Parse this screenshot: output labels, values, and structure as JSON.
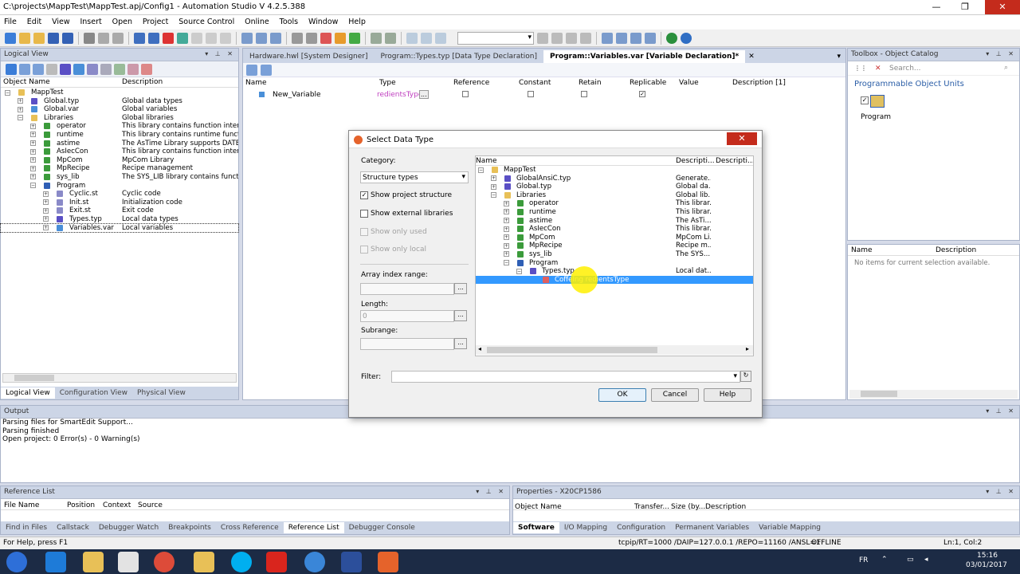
{
  "window": {
    "title": "C:\\projects\\MappTest\\MappTest.apj/Config1 - Automation Studio V 4.2.5.388"
  },
  "menu": [
    "File",
    "Edit",
    "View",
    "Insert",
    "Open",
    "Project",
    "Source Control",
    "Online",
    "Tools",
    "Window",
    "Help"
  ],
  "logical_view": {
    "title": "Logical View",
    "col_name": "Object Name",
    "col_desc": "Description",
    "rows": [
      {
        "name": "MappTest",
        "desc": ""
      },
      {
        "name": "Global.typ",
        "desc": "Global data types"
      },
      {
        "name": "Global.var",
        "desc": "Global variables"
      },
      {
        "name": "Libraries",
        "desc": "Global libraries"
      },
      {
        "name": "operator",
        "desc": "This library contains function interface"
      },
      {
        "name": "runtime",
        "desc": "This library contains runtime functions"
      },
      {
        "name": "astime",
        "desc": "The AsTime Library supports DATE_"
      },
      {
        "name": "AsIecCon",
        "desc": "This library contains function interface"
      },
      {
        "name": "MpCom",
        "desc": "MpCom Library"
      },
      {
        "name": "MpRecipe",
        "desc": "Recipe management"
      },
      {
        "name": "sys_lib",
        "desc": "The SYS_LIB library contains functior"
      },
      {
        "name": "Program",
        "desc": ""
      },
      {
        "name": "Cyclic.st",
        "desc": "Cyclic code"
      },
      {
        "name": "Init.st",
        "desc": "Initialization code"
      },
      {
        "name": "Exit.st",
        "desc": "Exit code"
      },
      {
        "name": "Types.typ",
        "desc": "Local data types"
      },
      {
        "name": "Variables.var",
        "desc": "Local variables"
      }
    ],
    "tabs": [
      "Logical View",
      "Configuration View",
      "Physical View"
    ]
  },
  "editor": {
    "tabs": [
      "Hardware.hwl [System Designer]",
      "Program::Types.typ [Data Type Declaration]",
      "Program::Variables.var [Variable Declaration]*"
    ],
    "columns": [
      "Name",
      "Type",
      "Reference",
      "Constant",
      "Retain",
      "Replicable",
      "Value",
      "Description [1]"
    ],
    "row": {
      "name": "New_Variable",
      "type": "redientsType",
      "type_btn": "..."
    }
  },
  "dialog": {
    "title": "Select Data Type",
    "close": "✕",
    "category_label": "Category:",
    "category_value": "Structure types",
    "show_project_structure": "Show project structure",
    "show_external_libraries": "Show external libraries",
    "show_only_used": "Show only used",
    "show_only_local": "Show only local",
    "array_index_range": "Array index range:",
    "length_label": "Length:",
    "length_value": "0",
    "subrange_label": "Subrange:",
    "filter_label": "Filter:",
    "ok": "OK",
    "cancel": "Cancel",
    "help": "Help",
    "tree_cols": [
      "Name",
      "Descripti...",
      "Descripti..."
    ],
    "tree": [
      {
        "name": "MappTest",
        "desc": ""
      },
      {
        "name": "GlobalAnsiC.typ",
        "desc": "Generate..."
      },
      {
        "name": "Global.typ",
        "desc": "Global da..."
      },
      {
        "name": "Libraries",
        "desc": "Global lib..."
      },
      {
        "name": "operator",
        "desc": "This librar..."
      },
      {
        "name": "runtime",
        "desc": "This librar..."
      },
      {
        "name": "astime",
        "desc": "The AsTi..."
      },
      {
        "name": "AsIecCon",
        "desc": "This librar..."
      },
      {
        "name": "MpCom",
        "desc": "MpCom Li..."
      },
      {
        "name": "MpRecipe",
        "desc": "Recipe m..."
      },
      {
        "name": "sys_lib",
        "desc": "The SYS..."
      },
      {
        "name": "Program",
        "desc": ""
      },
      {
        "name": "Types.typ",
        "desc": "Local dat..."
      },
      {
        "name": "CoffeIng   redientsType",
        "desc": ""
      }
    ]
  },
  "toolbox": {
    "title": "Toolbox - Object Catalog",
    "search_placeholder": "Search...",
    "section": "Programmable Object Units",
    "item": "Program"
  },
  "properties_side": {
    "col_name": "Name",
    "col_desc": "Description",
    "empty": "No items for current selection available."
  },
  "output": {
    "title": "Output",
    "lines": [
      "Parsing files for SmartEdit Support...",
      "Parsing finished",
      "Open project: 0 Error(s) - 0 Warning(s)"
    ]
  },
  "reference_list": {
    "title": "Reference List",
    "cols": [
      "File Name",
      "Position",
      "Context",
      "Source"
    ],
    "tabs": [
      "Find in Files",
      "Callstack",
      "Debugger Watch",
      "Breakpoints",
      "Cross Reference",
      "Reference List",
      "Debugger Console"
    ]
  },
  "properties_bottom": {
    "title": "Properties - X20CP1586",
    "cols": [
      "Object Name",
      "Transfer...",
      "Size (by...",
      "Description"
    ],
    "tabs": [
      "Software",
      "I/O Mapping",
      "Configuration",
      "Permanent Variables",
      "Variable Mapping"
    ]
  },
  "status": {
    "help": "For Help, press F1",
    "connection": "tcpip/RT=1000 /DAIP=127.0.0.1 /REPO=11160 /ANSL=1",
    "mode": "OFFLINE",
    "pos": "Ln:1, Col:2"
  },
  "taskbar": {
    "lang": "FR",
    "time": "15:16",
    "date": "03/01/2017"
  }
}
